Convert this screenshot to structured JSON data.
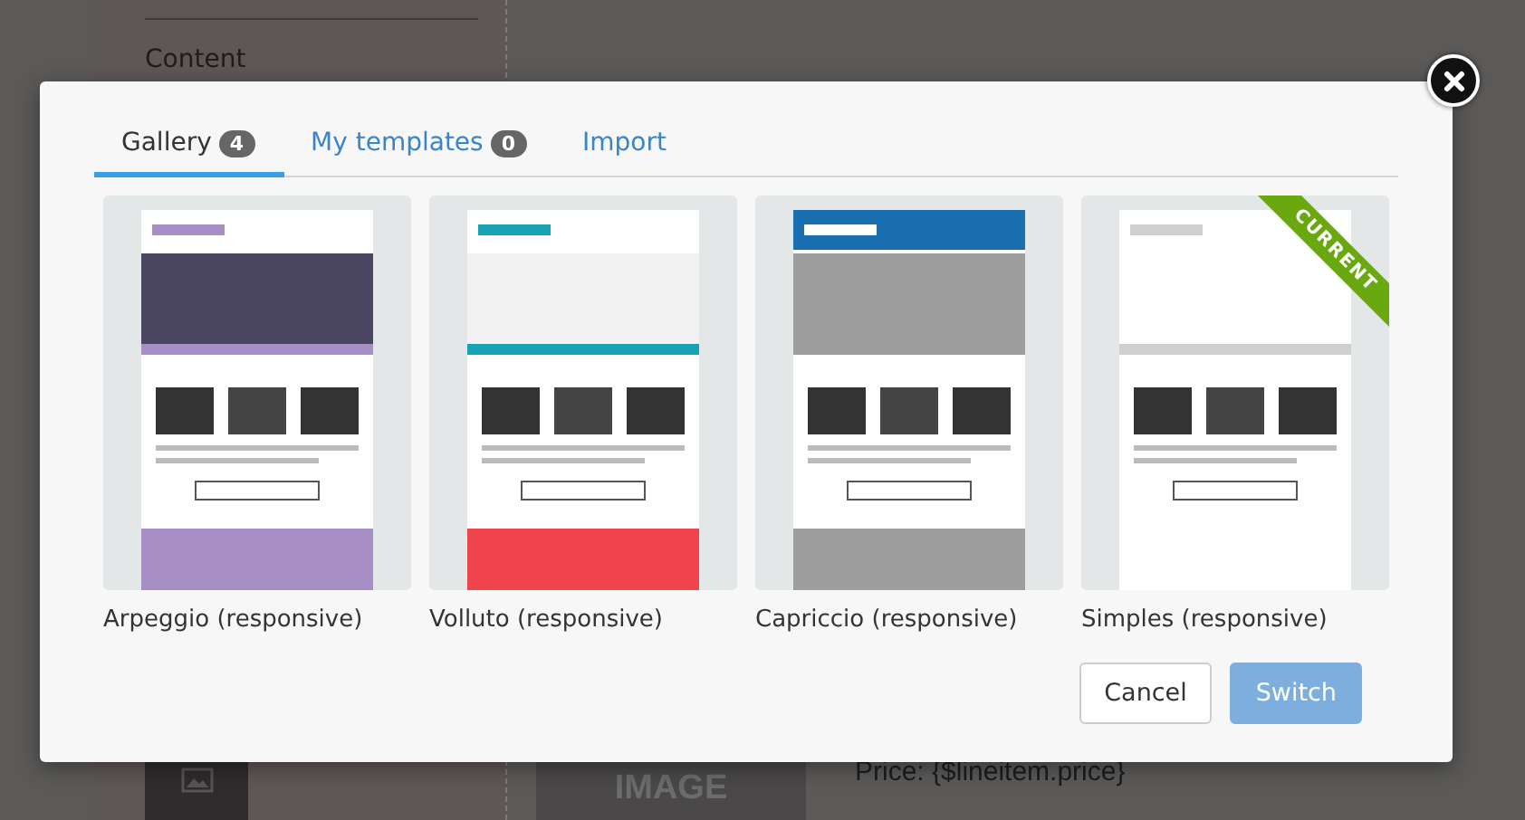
{
  "background": {
    "sidebar_item": "Content",
    "product_image": "IMAGE",
    "price": "Price: {$lineitem.price}"
  },
  "dialog": {
    "tabs": [
      {
        "label": "Gallery",
        "count": "4",
        "selected": true
      },
      {
        "label": "My templates",
        "count": "0",
        "selected": false
      },
      {
        "label": "Import",
        "selected": false
      }
    ],
    "templates": [
      {
        "name": "Arpeggio (responsive)",
        "current": false
      },
      {
        "name": "Volluto (responsive)",
        "current": false
      },
      {
        "name": "Capriccio (responsive)",
        "current": false
      },
      {
        "name": "Simples (responsive)",
        "current": true,
        "badge": "CURRENT"
      }
    ],
    "buttons": [
      {
        "label": "Cancel",
        "kind": "secondary"
      },
      {
        "label": "Switch",
        "kind": "primary"
      }
    ]
  }
}
